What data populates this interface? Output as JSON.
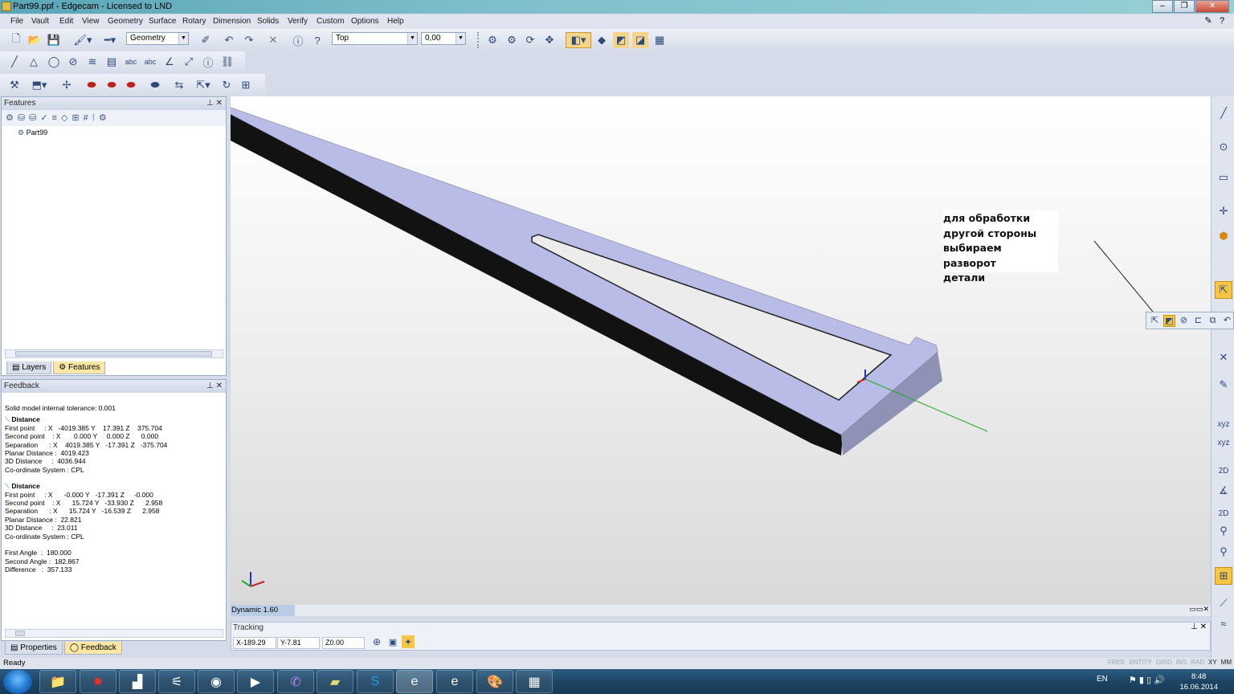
{
  "window": {
    "title": "Part99.ppf - Edgecam - Licensed to LND",
    "buttons": {
      "minimize": "‒",
      "maximize": "❐",
      "close": "✕"
    }
  },
  "menu": [
    "File",
    "Vault",
    "Edit",
    "View",
    "Geometry",
    "Surface",
    "Rotary",
    "Dimension",
    "Solids",
    "Verify",
    "Custom",
    "Options",
    "Help"
  ],
  "toolbar": {
    "layer_combo": "Geometry",
    "view_combo": "Top",
    "depth_combo": "0,00"
  },
  "features_panel": {
    "title": "Features",
    "tree_root": "Part99",
    "tabs": [
      "Layers",
      "Features"
    ],
    "active_tab": "Features"
  },
  "feedback_panel": {
    "title": "Feedback",
    "tolerance": "Solid model internal tolerance: 0.001",
    "blocks": [
      {
        "heading": "Distance",
        "lines": [
          "First point     : X   -4019.385 Y    17.391 Z    375.704",
          "Second point    : X       0.000 Y     0.000 Z      0.000",
          "Separation      : X    4019.385 Y   -17.391 Z   -375.704",
          "Planar Distance :  4019.423",
          "3D Distance     :  4036.944",
          "Co-ordinate System : CPL"
        ]
      },
      {
        "heading": "Distance",
        "lines": [
          "First point     : X      -0.000 Y   -17.391 Z     -0.000",
          "Second point    : X      15.724 Y   -33.930 Z      2.958",
          "Separation      : X      15.724 Y   -16.539 Z      2.958",
          "Planar Distance :  22.821",
          "3D Distance     :  23.011",
          "Co-ordinate System : CPL"
        ]
      }
    ],
    "angles": [
      "First Angle  :  180.000",
      "Second Angle :  182.867",
      "Difference   :  357.133"
    ],
    "tabs": [
      "Properties",
      "Feedback"
    ],
    "active_tab": "Feedback"
  },
  "viewport": {
    "note_lines": [
      "для обработки",
      "другой стороны",
      "выбираем разворот",
      "детали"
    ],
    "part_color": "#b9bce6",
    "side_color": "#111111"
  },
  "view_status": {
    "mode": "Dynamic 1.60"
  },
  "tracking": {
    "title": "Tracking",
    "x": "X-189.29",
    "y": "Y-7.81",
    "z": "Z0.00"
  },
  "status": {
    "text": "Ready",
    "modes": [
      "FREE",
      "ENTITY",
      "GRID",
      "INS",
      "RAD",
      "XY",
      "MM"
    ],
    "active_modes": [
      "XY",
      "MM"
    ]
  },
  "taskbar": {
    "language": "EN",
    "time": "8:48",
    "date": "16.06.2014"
  }
}
